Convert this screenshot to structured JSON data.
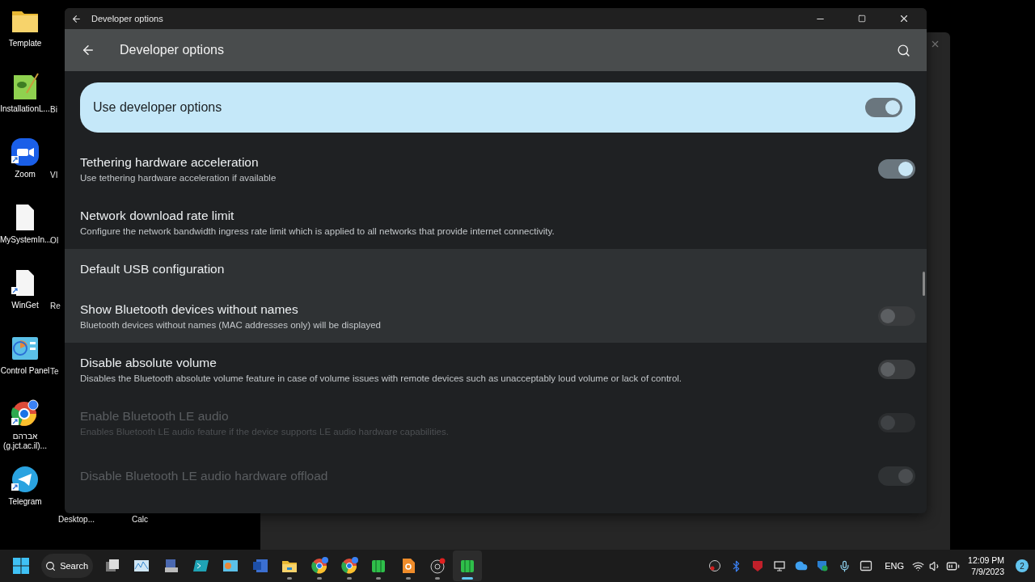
{
  "desktop": {
    "icons": [
      {
        "kind": "folder",
        "label": "Template",
        "shortcut": false
      },
      {
        "kind": "editor",
        "label": "InstallationL...",
        "shortcut": false
      },
      {
        "kind": "zoom",
        "label": "Zoom",
        "shortcut": true
      },
      {
        "kind": "file",
        "label": "MySystemIn...",
        "shortcut": false
      },
      {
        "kind": "file",
        "label": "WinGet",
        "shortcut": true
      },
      {
        "kind": "control-panel",
        "label": "Control Panel",
        "shortcut": false
      },
      {
        "kind": "chrome",
        "label": "אברהם (g.jct.ac.il)...",
        "shortcut": true
      },
      {
        "kind": "telegram",
        "label": "Telegram",
        "shortcut": true
      }
    ],
    "partial_labels": [
      "Bi",
      "VI",
      "OI",
      "Re",
      "Te"
    ],
    "bottom_labels": [
      "Desktop...",
      "Calc"
    ]
  },
  "window": {
    "title": "Developer options",
    "app_bar_title": "Developer options",
    "main_switch": {
      "label": "Use developer options",
      "on": true
    },
    "rows": [
      {
        "kind": "switch",
        "title": "Tethering hardware acceleration",
        "summary": "Use tethering hardware acceleration if available",
        "on": true,
        "disabled": false,
        "highlighted": false
      },
      {
        "kind": "text",
        "title": "Network download rate limit",
        "summary": "Configure the network bandwidth ingress rate limit which is applied to all networks that provide internet connectivity.",
        "disabled": false,
        "highlighted": false
      },
      {
        "kind": "text",
        "title": "Default USB configuration",
        "disabled": false,
        "highlighted": true
      },
      {
        "kind": "switch",
        "title": "Show Bluetooth devices without names",
        "summary": "Bluetooth devices without names (MAC addresses only) will be displayed",
        "on": false,
        "disabled": false,
        "highlighted": true
      },
      {
        "kind": "switch",
        "title": "Disable absolute volume",
        "summary": "Disables the Bluetooth absolute volume feature in case of volume issues with remote devices such as unacceptably loud volume or lack of control.",
        "on": false,
        "disabled": false,
        "highlighted": false
      },
      {
        "kind": "switch",
        "title": "Enable Bluetooth LE audio",
        "summary": "Enables Bluetooth LE audio feature if the device supports LE audio hardware capabilities.",
        "on": false,
        "disabled": true,
        "highlighted": false
      },
      {
        "kind": "switch",
        "title": "Disable Bluetooth LE audio hardware offload",
        "on": true,
        "disabled": true,
        "highlighted": false
      }
    ]
  },
  "taskbar": {
    "search_label": "Search",
    "apps": [
      {
        "kind": "task-view",
        "running": false,
        "selected": false
      },
      {
        "kind": "monitor",
        "running": false,
        "selected": false
      },
      {
        "kind": "network",
        "running": false,
        "selected": false
      },
      {
        "kind": "terminal",
        "running": false,
        "selected": false
      },
      {
        "kind": "control-panel",
        "running": false,
        "selected": false
      },
      {
        "kind": "word",
        "running": false,
        "selected": false
      },
      {
        "kind": "folder",
        "running": true,
        "selected": false
      },
      {
        "kind": "chrome",
        "running": true,
        "selected": false
      },
      {
        "kind": "chrome",
        "running": true,
        "selected": false
      },
      {
        "kind": "green",
        "running": true,
        "selected": false
      },
      {
        "kind": "pdf",
        "running": true,
        "selected": false
      },
      {
        "kind": "obs",
        "running": true,
        "selected": false
      },
      {
        "kind": "green",
        "running": true,
        "selected": true
      }
    ],
    "tray": [
      {
        "kind": "obs"
      },
      {
        "kind": "bluetooth"
      },
      {
        "kind": "shield"
      },
      {
        "kind": "pc"
      },
      {
        "kind": "cloud"
      },
      {
        "kind": "security"
      },
      {
        "kind": "mic"
      },
      {
        "kind": "tablet"
      }
    ],
    "language": "ENG",
    "time": "12:09 PM",
    "date": "7/9/2023",
    "notifications": "2"
  }
}
